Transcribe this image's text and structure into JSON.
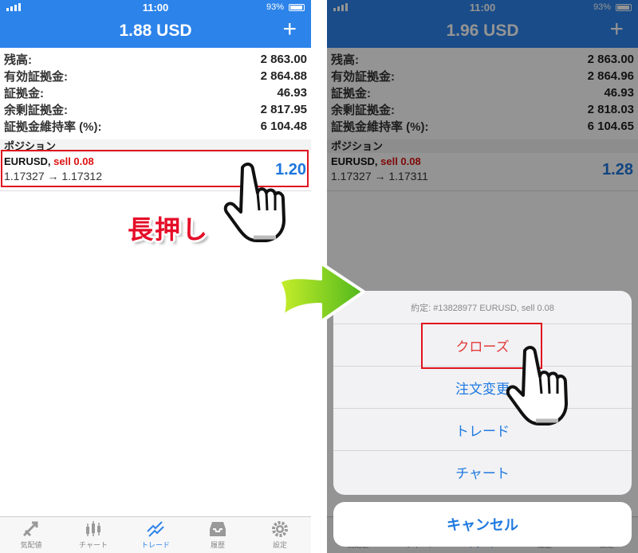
{
  "status": {
    "time": "11:00",
    "battery": "93%"
  },
  "left": {
    "title": "1.88 USD",
    "add": "+",
    "rows": [
      {
        "label": "残高:",
        "value": "2 863.00"
      },
      {
        "label": "有効証拠金:",
        "value": "2 864.88"
      },
      {
        "label": "証拠金:",
        "value": "46.93"
      },
      {
        "label": "余剰証拠金:",
        "value": "2 817.95"
      },
      {
        "label": "証拠金維持率 (%):",
        "value": "6 104.48"
      }
    ],
    "section": "ポジション",
    "position": {
      "symbol": "EURUSD,",
      "side": "sell 0.08",
      "prices": "1.17327 → 1.17312",
      "pl": "1.20"
    }
  },
  "right": {
    "title": "1.96 USD",
    "add": "+",
    "rows": [
      {
        "label": "残高:",
        "value": "2 863.00"
      },
      {
        "label": "有効証拠金:",
        "value": "2 864.96"
      },
      {
        "label": "証拠金:",
        "value": "46.93"
      },
      {
        "label": "余剰証拠金:",
        "value": "2 818.03"
      },
      {
        "label": "証拠金維持率 (%):",
        "value": "6 104.65"
      }
    ],
    "section": "ポジション",
    "position": {
      "symbol": "EURUSD,",
      "side": "sell 0.08",
      "prices": "1.17327 → 1.17311",
      "pl": "1.28"
    },
    "sheet": {
      "header": "約定: #13828977 EURUSD, sell 0.08",
      "actions": [
        "クローズ",
        "注文変更",
        "トレード",
        "チャート"
      ],
      "cancel": "キャンセル"
    }
  },
  "tabs": [
    "気配値",
    "チャート",
    "トレード",
    "履歴",
    "設定"
  ],
  "annotation": "長押し",
  "colors": {
    "accent": "#2c83ea",
    "highlight": "#e0141e",
    "sell": "#d11111"
  }
}
